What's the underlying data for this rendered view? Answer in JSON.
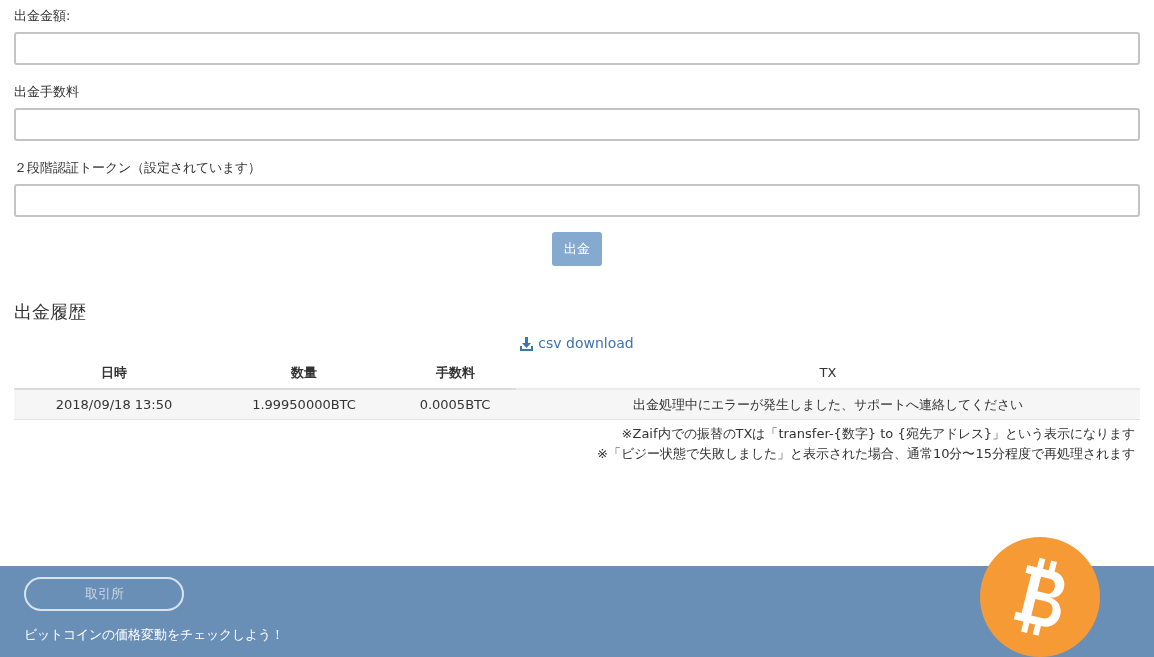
{
  "form": {
    "fields": [
      {
        "label": "出金金額:"
      },
      {
        "label": "出金手数料"
      },
      {
        "label": "２段階認証トークン（設定されています）"
      }
    ],
    "submit": {
      "label": "出金",
      "disabled": true
    }
  },
  "history": {
    "title": "出金履歴",
    "csv_link": "csv download",
    "table": {
      "columns": [
        "日時",
        "数量",
        "手数料",
        "TX"
      ],
      "rows": [
        [
          "2018/09/18 13:50",
          "1.99950000BTC",
          "0.0005BTC",
          "出金処理中にエラーが発生しました、サポートへ連絡してください"
        ]
      ]
    },
    "notes": [
      "※Zaif内での振替のTXは「transfer-{数字} to {宛先アドレス}」という表示になります",
      "※「ビジー状態で失敗しました」と表示された場合、通常10分〜15分程度で再処理されます"
    ]
  },
  "footer": {
    "button": "取引所",
    "text": "ビットコインの価格変動をチェックしよう！"
  }
}
